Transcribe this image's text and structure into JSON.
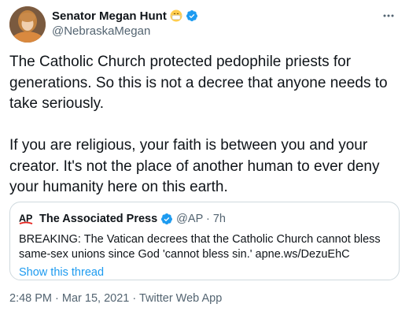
{
  "author": {
    "display_name": "Senator Megan Hunt",
    "handle": "@NebraskaMegan"
  },
  "tweet": {
    "text": "The Catholic Church protected pedophile priests for generations. So this is not a decree that anyone needs to take seriously.\n\nIf you are religious, your faith is between you and your creator. It's not the place of another human to ever deny your humanity here on this earth."
  },
  "quoted_tweet": {
    "display_name": "The Associated Press",
    "handle_time": "@AP · 7h",
    "text": "BREAKING: The Vatican decrees that the Catholic Church cannot bless same-sex unions since God 'cannot bless sin.' apne.ws/DezuEhC",
    "show_thread": "Show this thread"
  },
  "meta": {
    "timestamp_source": "2:48 PM · Mar 15, 2021 · Twitter Web App"
  },
  "icons": {
    "author_emoji": "mask-face-emoji-icon",
    "verified": "verified-badge-icon",
    "more": "more-icon",
    "quoted_logo": "ap-logo-icon"
  },
  "colors": {
    "text_primary": "#0f1419",
    "text_secondary": "#536471",
    "link": "#1d9bf0",
    "verified": "#1d9bf0",
    "border": "#cfd9de",
    "ap_red": "#e6231e"
  }
}
